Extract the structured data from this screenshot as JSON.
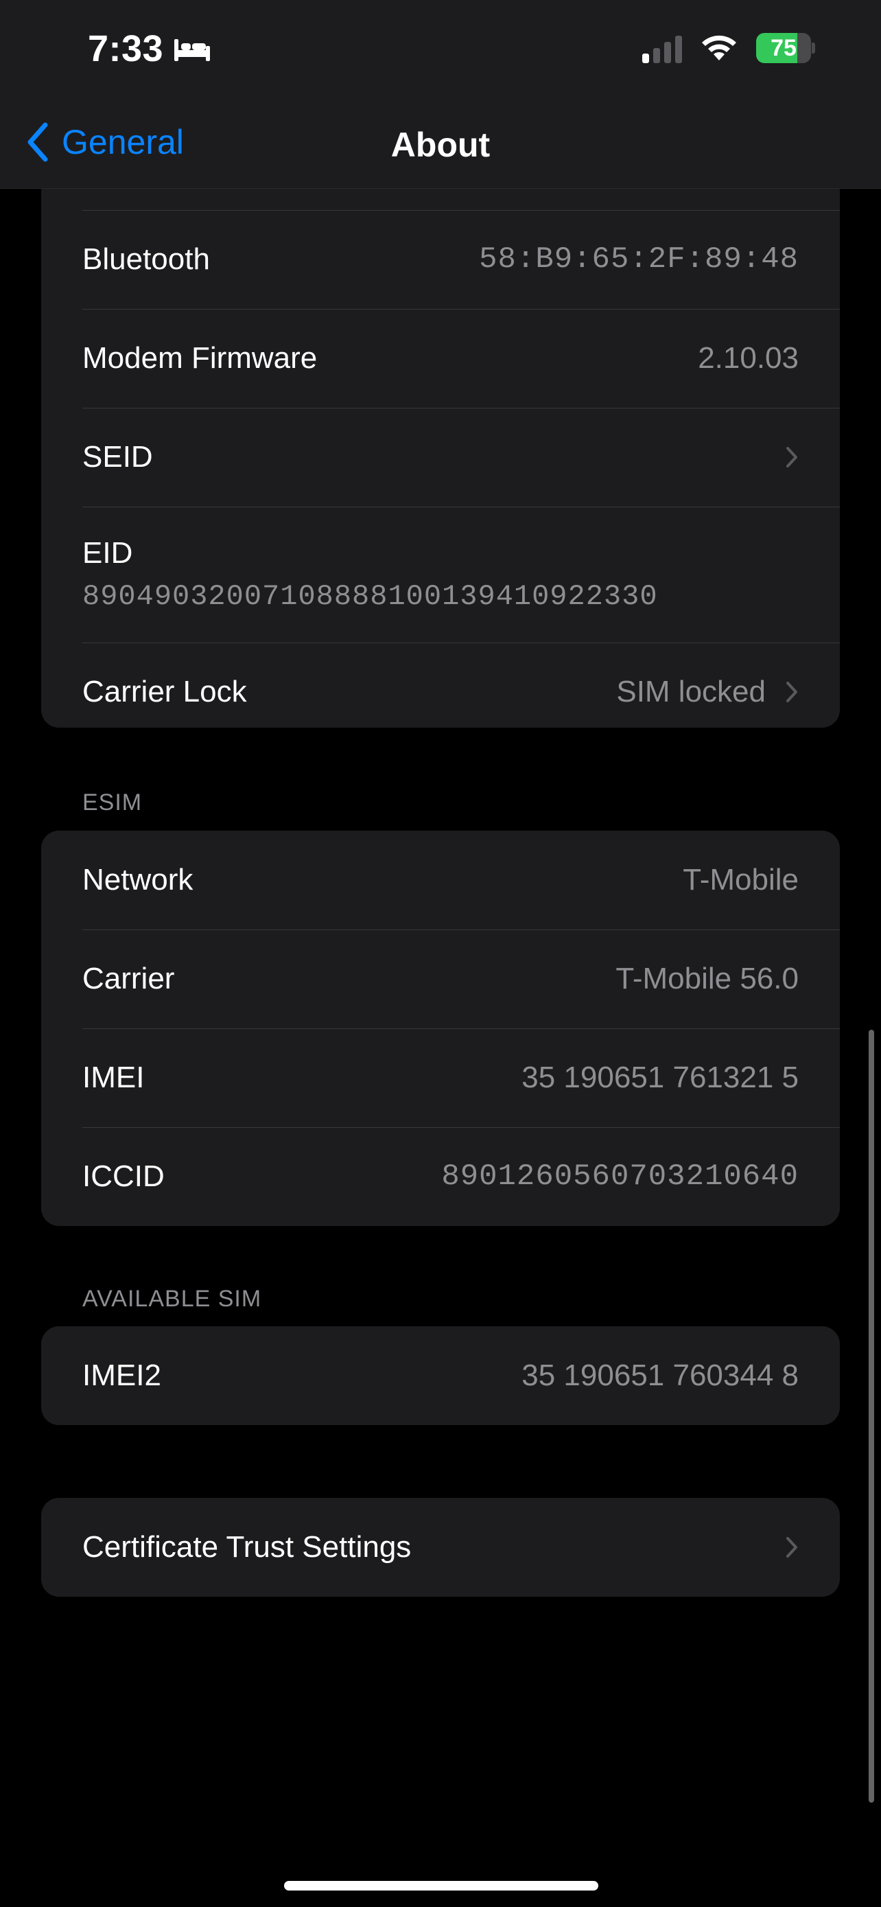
{
  "status_bar": {
    "time": "7:33",
    "battery_percent": "75",
    "battery_level": 0.75,
    "signal_bars_active": 1,
    "signal_bars_total": 4
  },
  "nav": {
    "back_label": "General",
    "title": "About"
  },
  "device_info": [
    {
      "label": "Bluetooth",
      "value": "58:B9:65:2F:89:48"
    },
    {
      "label": "Modem Firmware",
      "value": "2.10.03"
    },
    {
      "label": "SEID",
      "value": ""
    },
    {
      "label": "EID",
      "value": "89049032007108888100139410922330"
    },
    {
      "label": "Carrier Lock",
      "value": "SIM locked"
    }
  ],
  "esim": {
    "header": "ESIM",
    "rows": [
      {
        "label": "Network",
        "value": "T-Mobile"
      },
      {
        "label": "Carrier",
        "value": "T-Mobile 56.0"
      },
      {
        "label": "IMEI",
        "value": "35 190651 761321 5"
      },
      {
        "label": "ICCID",
        "value": "8901260560703210640"
      }
    ]
  },
  "available_sim": {
    "header": "AVAILABLE SIM",
    "rows": [
      {
        "label": "IMEI2",
        "value": "35 190651 760344 8"
      }
    ]
  },
  "certificate": {
    "label": "Certificate Trust Settings"
  },
  "colors": {
    "accent": "#0a84ff",
    "card_bg": "#1c1c1e",
    "secondary_text": "#8e8e93",
    "battery_green": "#34c759"
  }
}
